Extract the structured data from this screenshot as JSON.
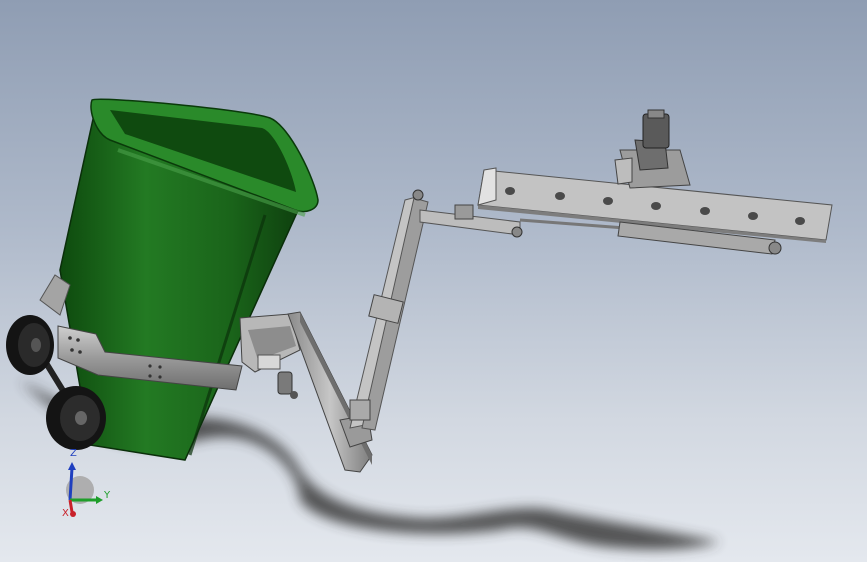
{
  "viewport": {
    "model_name": "garbage-bin-lifting-arm-assembly"
  },
  "triad": {
    "z_label": "Z",
    "y_label": "Y",
    "x_label": "X",
    "colors": {
      "z_axis": "#1f3fbf",
      "y_axis": "#1e9e2a",
      "x_axis": "#c8202a"
    }
  },
  "colors": {
    "bin_green": "#1d6b1d",
    "bin_dark": "#0f3f0f",
    "steel": "#a6a6a6",
    "steel_dark": "#6d6d6d",
    "wheel": "#1a1a1a"
  }
}
